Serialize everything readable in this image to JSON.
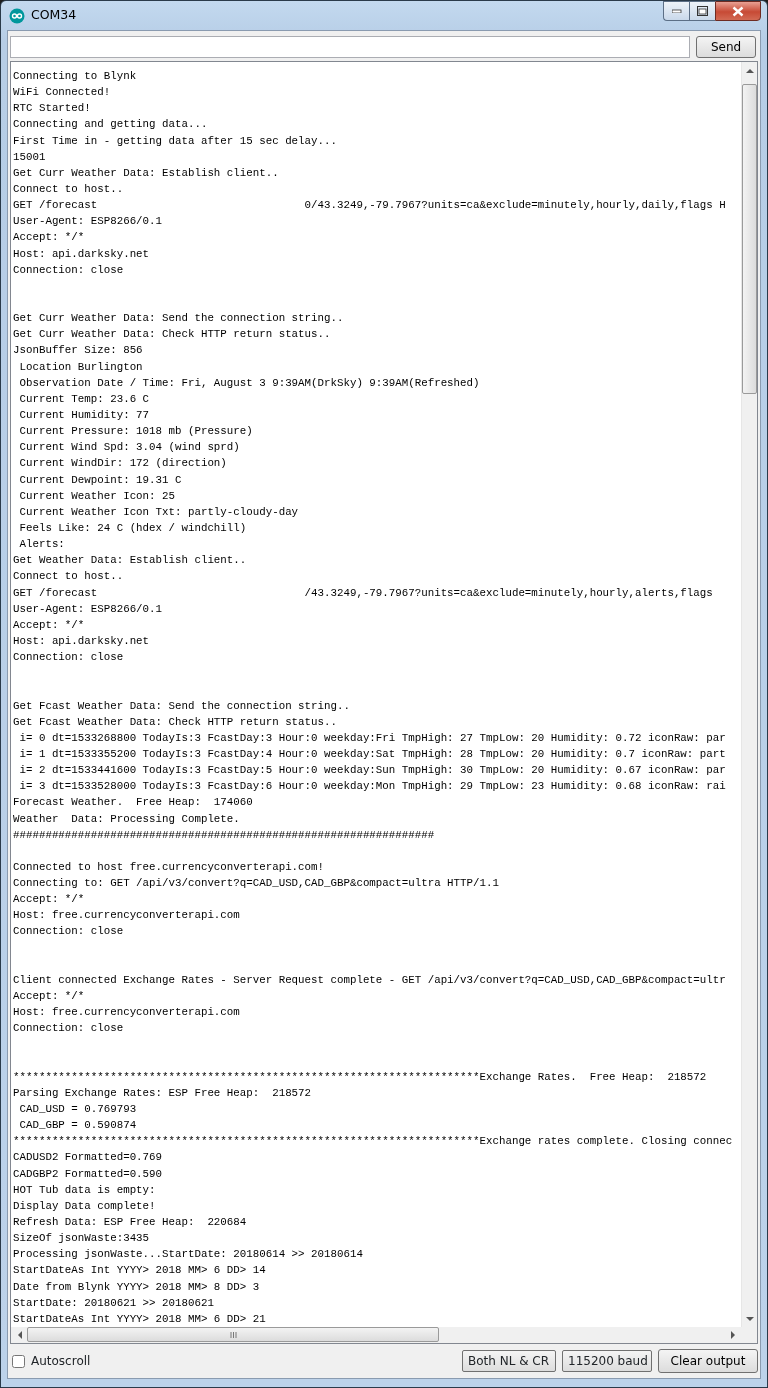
{
  "window": {
    "title": "COM34"
  },
  "send_button": "Send",
  "lines": [
    {
      "kind": "text",
      "text": "Connecting to Blynk"
    },
    {
      "kind": "text",
      "text": "WiFi Connected!"
    },
    {
      "kind": "text",
      "text": "RTC Started!"
    },
    {
      "kind": "text",
      "text": "Connecting and getting data..."
    },
    {
      "kind": "text",
      "text": "First Time in - getting data after 15 sec delay..."
    },
    {
      "kind": "text",
      "text": "15001"
    },
    {
      "kind": "text",
      "text": "Get Curr Weather Data: Establish client.."
    },
    {
      "kind": "text",
      "text": "Connect to host.."
    },
    {
      "kind": "split",
      "parts": [
        "GET /forecast",
        "0/43.3249,-79.7967?units=ca&exclude=minutely,hourly,daily,flags H"
      ]
    },
    {
      "kind": "text",
      "text": "User-Agent: ESP8266/0.1"
    },
    {
      "kind": "text",
      "text": "Accept: */*"
    },
    {
      "kind": "text",
      "text": "Host: api.darksky.net"
    },
    {
      "kind": "text",
      "text": "Connection: close"
    },
    {
      "kind": "blank"
    },
    {
      "kind": "blank"
    },
    {
      "kind": "text",
      "text": "Get Curr Weather Data: Send the connection string.."
    },
    {
      "kind": "text",
      "text": "Get Curr Weather Data: Check HTTP return status.."
    },
    {
      "kind": "text",
      "text": "JsonBuffer Size: 856"
    },
    {
      "kind": "text",
      "text": " Location Burlington"
    },
    {
      "kind": "text",
      "text": " Observation Date / Time: Fri, August 3 9:39AM(DrkSky) 9:39AM(Refreshed)"
    },
    {
      "kind": "text",
      "text": " Current Temp: 23.6 C"
    },
    {
      "kind": "text",
      "text": " Current Humidity: 77"
    },
    {
      "kind": "text",
      "text": " Current Pressure: 1018 mb (Pressure)"
    },
    {
      "kind": "text",
      "text": " Current Wind Spd: 3.04 (wind sprd)"
    },
    {
      "kind": "text",
      "text": " Current WindDir: 172 (direction)"
    },
    {
      "kind": "text",
      "text": " Current Dewpoint: 19.31 C"
    },
    {
      "kind": "text",
      "text": " Current Weather Icon: 25"
    },
    {
      "kind": "text",
      "text": " Current Weather Icon Txt: partly-cloudy-day"
    },
    {
      "kind": "text",
      "text": " Feels Like: 24 C (hdex / windchill)"
    },
    {
      "kind": "text",
      "text": " Alerts:"
    },
    {
      "kind": "text",
      "text": "Get Weather Data: Establish client.."
    },
    {
      "kind": "text",
      "text": "Connect to host.."
    },
    {
      "kind": "split",
      "parts": [
        "GET /forecast",
        "/43.3249,-79.7967?units=ca&exclude=minutely,hourly,alerts,flags"
      ]
    },
    {
      "kind": "text",
      "text": "User-Agent: ESP8266/0.1"
    },
    {
      "kind": "text",
      "text": "Accept: */*"
    },
    {
      "kind": "text",
      "text": "Host: api.darksky.net"
    },
    {
      "kind": "text",
      "text": "Connection: close"
    },
    {
      "kind": "blank"
    },
    {
      "kind": "blank"
    },
    {
      "kind": "text",
      "text": "Get Fcast Weather Data: Send the connection string.."
    },
    {
      "kind": "text",
      "text": "Get Fcast Weather Data: Check HTTP return status.."
    },
    {
      "kind": "text",
      "text": " i= 0 dt=1533268800 TodayIs:3 FcastDay:3 Hour:0 weekday:Fri TmpHigh: 27 TmpLow: 20 Humidity: 0.72 iconRaw: par"
    },
    {
      "kind": "text",
      "text": " i= 1 dt=1533355200 TodayIs:3 FcastDay:4 Hour:0 weekday:Sat TmpHigh: 28 TmpLow: 20 Humidity: 0.7 iconRaw: part"
    },
    {
      "kind": "text",
      "text": " i= 2 dt=1533441600 TodayIs:3 FcastDay:5 Hour:0 weekday:Sun TmpHigh: 30 TmpLow: 20 Humidity: 0.67 iconRaw: par"
    },
    {
      "kind": "text",
      "text": " i= 3 dt=1533528000 TodayIs:3 FcastDay:6 Hour:0 weekday:Mon TmpHigh: 29 TmpLow: 23 Humidity: 0.68 iconRaw: rai"
    },
    {
      "kind": "text",
      "text": "Forecast Weather.  Free Heap:  174060"
    },
    {
      "kind": "text",
      "text": "Weather  Data: Processing Complete."
    },
    {
      "kind": "text",
      "text": "#################################################################"
    },
    {
      "kind": "blank"
    },
    {
      "kind": "text",
      "text": "Connected to host free.currencyconverterapi.com!"
    },
    {
      "kind": "text",
      "text": "Connecting to: GET /api/v3/convert?q=CAD_USD,CAD_GBP&compact=ultra HTTP/1.1"
    },
    {
      "kind": "text",
      "text": "Accept: */*"
    },
    {
      "kind": "text",
      "text": "Host: free.currencyconverterapi.com"
    },
    {
      "kind": "text",
      "text": "Connection: close"
    },
    {
      "kind": "blank"
    },
    {
      "kind": "blank"
    },
    {
      "kind": "text",
      "text": "Client connected Exchange Rates - Server Request complete - GET /api/v3/convert?q=CAD_USD,CAD_GBP&compact=ultr"
    },
    {
      "kind": "text",
      "text": "Accept: */*"
    },
    {
      "kind": "text",
      "text": "Host: free.currencyconverterapi.com"
    },
    {
      "kind": "text",
      "text": "Connection: close"
    },
    {
      "kind": "blank"
    },
    {
      "kind": "blank"
    },
    {
      "kind": "text",
      "text": "************************************************************************Exchange Rates.  Free Heap:  218572"
    },
    {
      "kind": "text",
      "text": "Parsing Exchange Rates: ESP Free Heap:  218572"
    },
    {
      "kind": "text",
      "text": " CAD_USD = 0.769793"
    },
    {
      "kind": "text",
      "text": " CAD_GBP = 0.590874"
    },
    {
      "kind": "text",
      "text": "************************************************************************Exchange rates complete. Closing connec"
    },
    {
      "kind": "text",
      "text": "CADUSD2 Formatted=0.769"
    },
    {
      "kind": "text",
      "text": "CADGBP2 Formatted=0.590"
    },
    {
      "kind": "text",
      "text": "HOT Tub data is empty:"
    },
    {
      "kind": "text",
      "text": "Display Data complete!"
    },
    {
      "kind": "text",
      "text": "Refresh Data: ESP Free Heap:  220684"
    },
    {
      "kind": "text",
      "text": "SizeOf jsonWaste:3435"
    },
    {
      "kind": "text",
      "text": "Processing jsonWaste...StartDate: 20180614 >> 20180614"
    },
    {
      "kind": "text",
      "text": "StartDateAs Int YYYY> 2018 MM> 6 DD> 14"
    },
    {
      "kind": "text",
      "text": "Date from Blynk YYYY> 2018 MM> 8 DD> 3"
    },
    {
      "kind": "text",
      "text": "StartDate: 20180621 >> 20180621"
    },
    {
      "kind": "text",
      "text": "StartDateAs Int YYYY> 2018 MM> 6 DD> 21"
    }
  ],
  "autoscroll": {
    "label": "Autoscroll",
    "checked": false
  },
  "line_ending": "Both NL & CR",
  "baud_rate": "115200 baud",
  "clear_button": "Clear output"
}
